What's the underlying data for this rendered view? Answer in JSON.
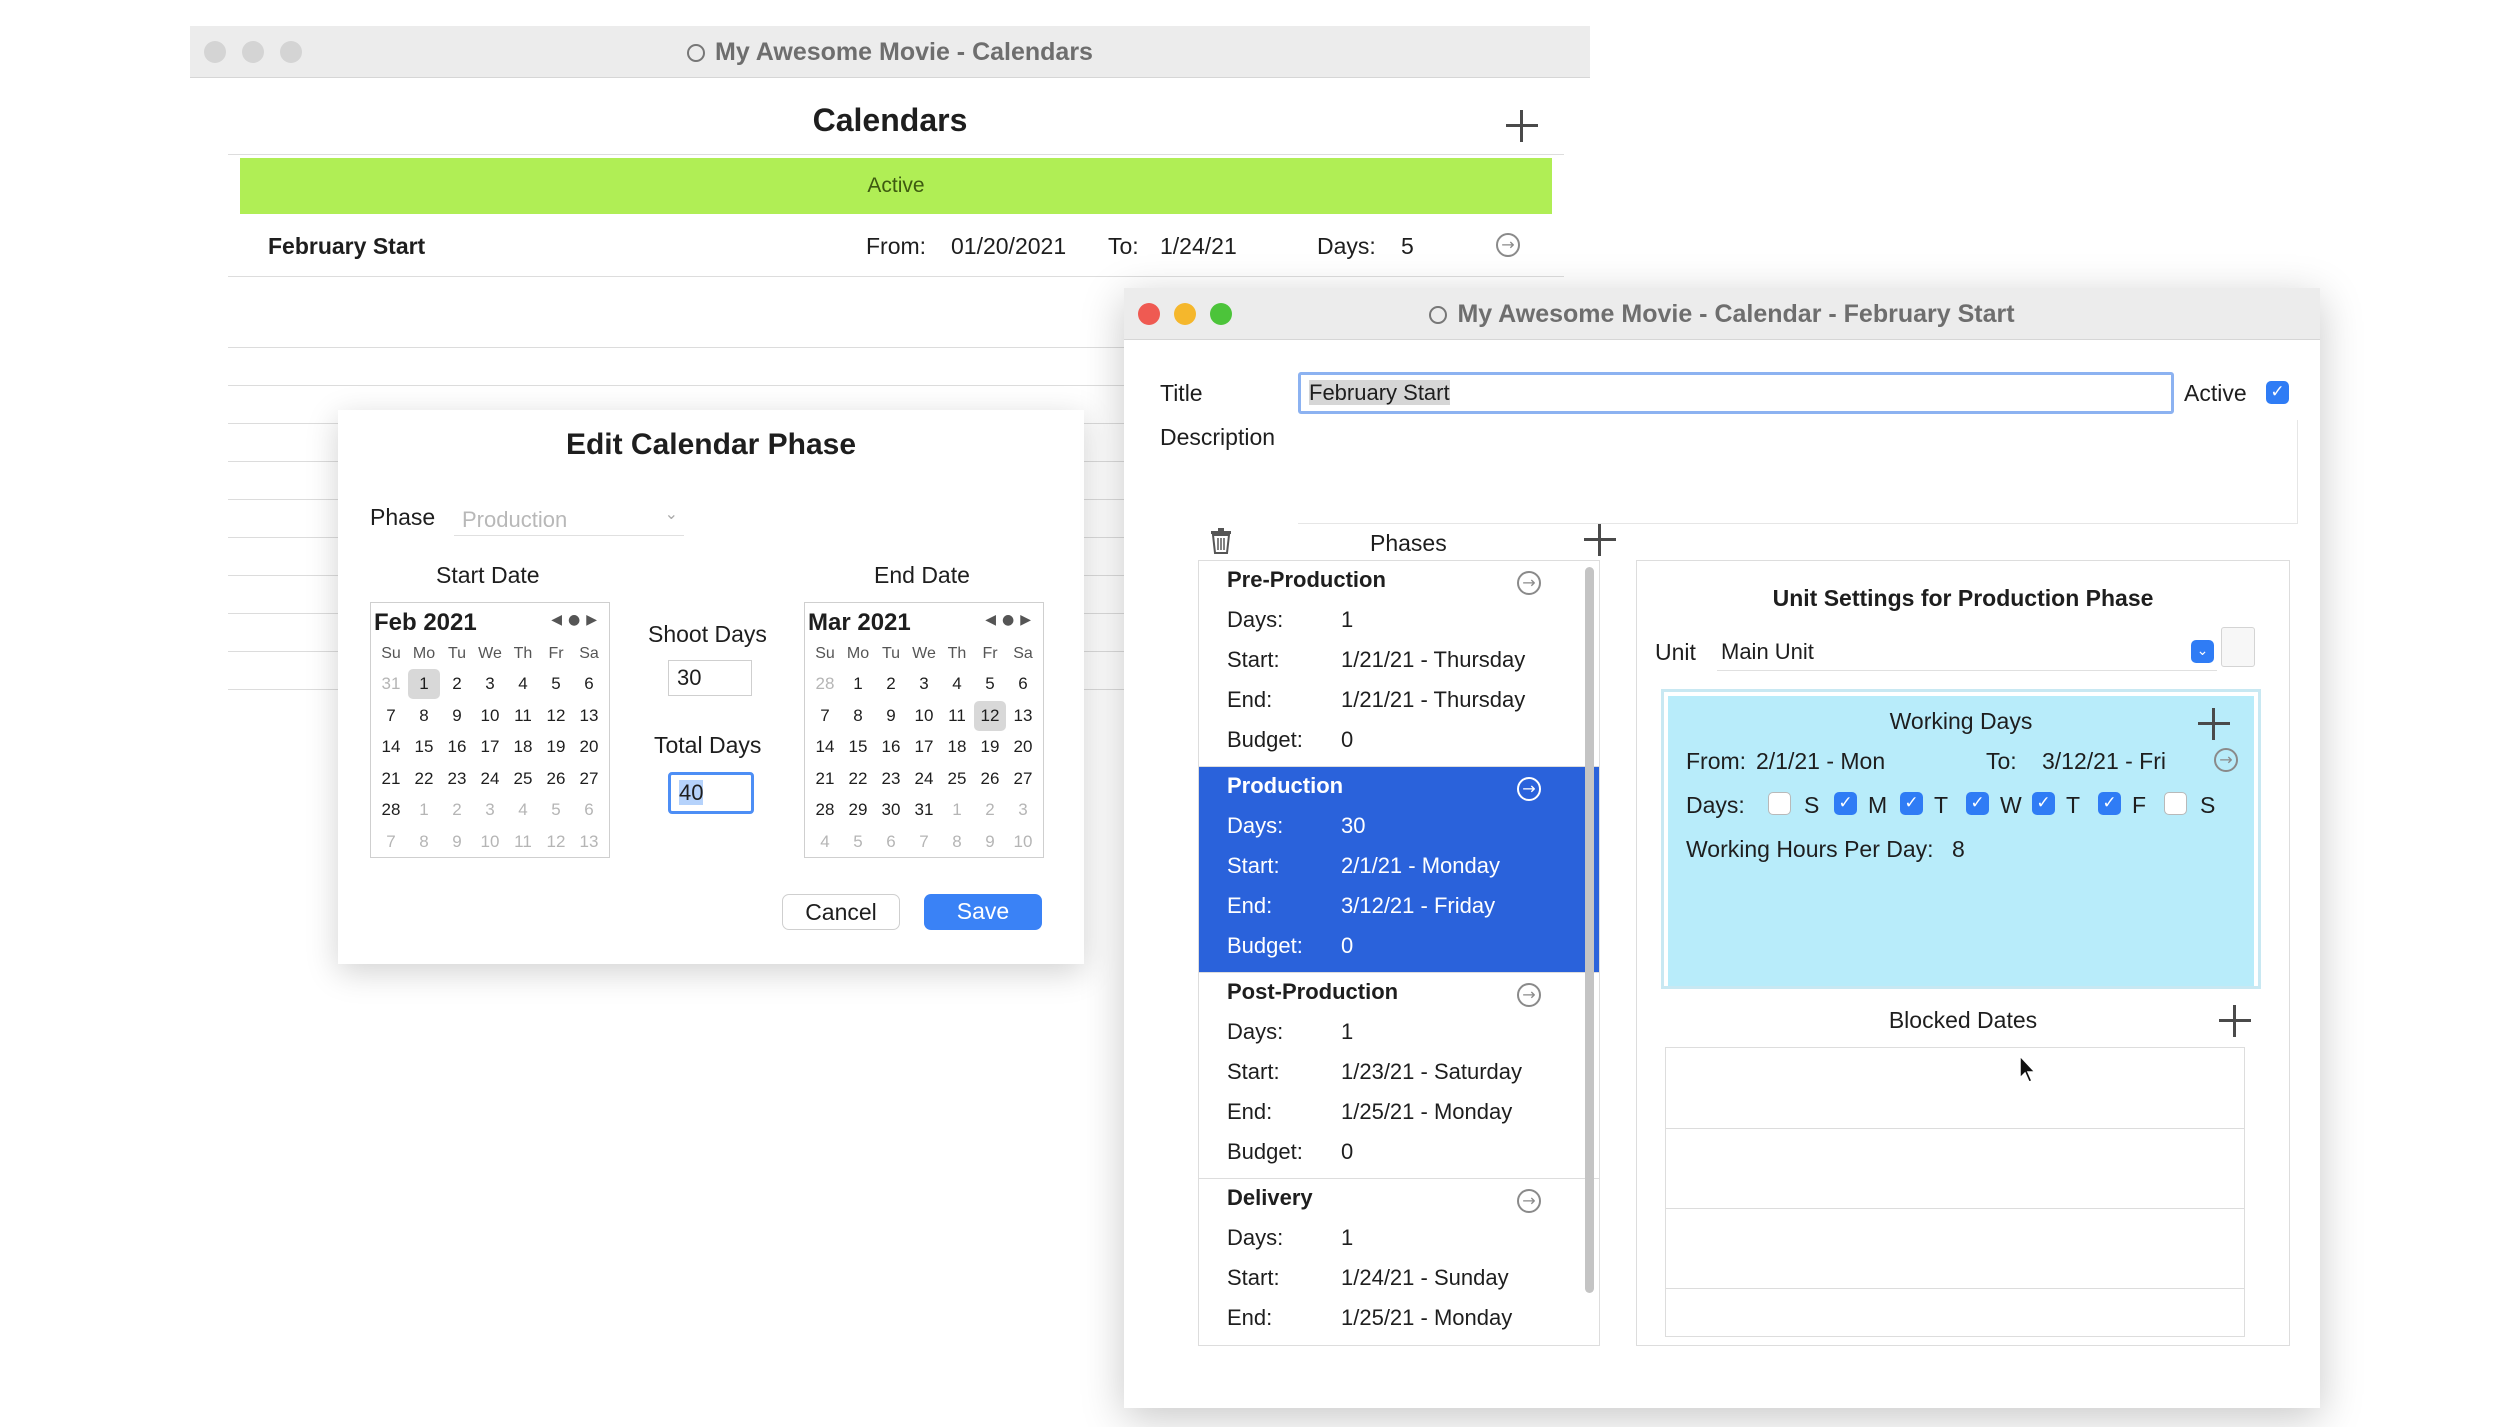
{
  "calendars_window": {
    "title": "My Awesome Movie - Calendars",
    "heading": "Calendars",
    "active_banner": "Active",
    "calendar_row": {
      "name": "February Start",
      "from_label": "From:",
      "from_value": "01/20/2021",
      "to_label": "To:",
      "to_value": "1/24/21",
      "days_label": "Days:",
      "days_value": "5"
    }
  },
  "edit_phase_dialog": {
    "heading": "Edit Calendar Phase",
    "phase_label": "Phase",
    "phase_value": "Production",
    "start_date_label": "Start Date",
    "end_date_label": "End Date",
    "start_calendar": {
      "month": "Feb 2021",
      "weekdays": [
        "Su",
        "Mo",
        "Tu",
        "We",
        "Th",
        "Fr",
        "Sa"
      ],
      "days": [
        "31",
        "1",
        "2",
        "3",
        "4",
        "5",
        "6",
        "7",
        "8",
        "9",
        "10",
        "11",
        "12",
        "13",
        "14",
        "15",
        "16",
        "17",
        "18",
        "19",
        "20",
        "21",
        "22",
        "23",
        "24",
        "25",
        "26",
        "27",
        "28",
        "1",
        "2",
        "3",
        "4",
        "5",
        "6",
        "7",
        "8",
        "9",
        "10",
        "11",
        "12",
        "13"
      ]
    },
    "end_calendar": {
      "month": "Mar 2021",
      "weekdays": [
        "Su",
        "Mo",
        "Tu",
        "We",
        "Th",
        "Fr",
        "Sa"
      ],
      "days": [
        "28",
        "1",
        "2",
        "3",
        "4",
        "5",
        "6",
        "7",
        "8",
        "9",
        "10",
        "11",
        "12",
        "13",
        "14",
        "15",
        "16",
        "17",
        "18",
        "19",
        "20",
        "21",
        "22",
        "23",
        "24",
        "25",
        "26",
        "27",
        "28",
        "29",
        "30",
        "31",
        "1",
        "2",
        "3",
        "4",
        "5",
        "6",
        "7",
        "8",
        "9",
        "10"
      ]
    },
    "shoot_days_label": "Shoot Days",
    "shoot_days_value": "30",
    "total_days_label": "Total Days",
    "total_days_value": "40",
    "cancel_label": "Cancel",
    "save_label": "Save"
  },
  "calendar_window": {
    "title": "My Awesome Movie - Calendar - February Start",
    "title_label": "Title",
    "title_value": "February Start",
    "active_label": "Active",
    "description_label": "Description",
    "phases_label": "Phases",
    "phases": [
      {
        "name": "Pre-Production",
        "days_label": "Days:",
        "days": "1",
        "start_label": "Start:",
        "start": "1/21/21 - Thursday",
        "end_label": "End:",
        "end": "1/21/21 - Thursday",
        "budget_label": "Budget:",
        "budget": "0"
      },
      {
        "name": "Production",
        "days_label": "Days:",
        "days": "30",
        "start_label": "Start:",
        "start": "2/1/21 - Monday",
        "end_label": "End:",
        "end": "3/12/21 - Friday",
        "budget_label": "Budget:",
        "budget": "0"
      },
      {
        "name": "Post-Production",
        "days_label": "Days:",
        "days": "1",
        "start_label": "Start:",
        "start": "1/23/21 - Saturday",
        "end_label": "End:",
        "end": "1/25/21 - Monday",
        "budget_label": "Budget:",
        "budget": "0"
      },
      {
        "name": "Delivery",
        "days_label": "Days:",
        "days": "1",
        "start_label": "Start:",
        "start": "1/24/21 - Sunday",
        "end_label": "End:",
        "end": "1/25/21 - Monday"
      }
    ],
    "unit_settings": {
      "heading": "Unit Settings for Production Phase",
      "unit_label": "Unit",
      "unit_value": "Main Unit",
      "working_days_label": "Working Days",
      "from_label": "From:",
      "from_value": "2/1/21 - Mon",
      "to_label": "To:",
      "to_value": "3/12/21 - Fri",
      "days_label": "Days:",
      "day_letters": [
        "S",
        "M",
        "T",
        "W",
        "T",
        "F",
        "S"
      ],
      "hours_label": "Working Hours Per Day:",
      "hours_value": "8",
      "blocked_dates_label": "Blocked Dates"
    }
  },
  "colors": {
    "active_banner": "#b0ee55",
    "selected_phase": "#2a62db",
    "working_days_bg": "#b8ecfa",
    "accent_blue": "#2f7cf5"
  }
}
